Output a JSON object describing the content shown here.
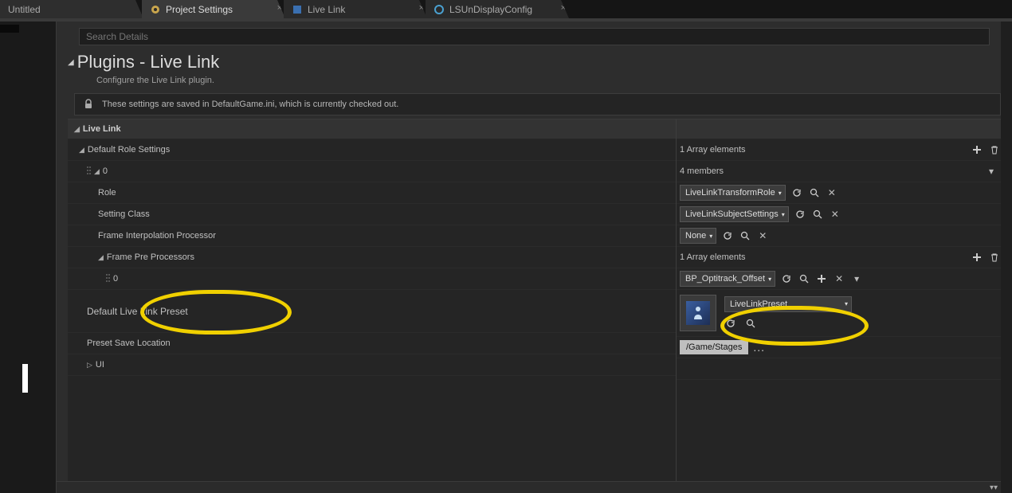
{
  "tabs": {
    "untitled": "Untitled",
    "project_settings": "Project Settings",
    "live_link": "Live Link",
    "display_config": "LSUnDisplayConfig"
  },
  "search": {
    "placeholder": "Search Details"
  },
  "page": {
    "title": "Plugins - Live Link",
    "subtitle": "Configure the Live Link plugin.",
    "info": "These settings are saved in DefaultGame.ini, which is currently checked out."
  },
  "section_live_link": "Live Link",
  "rows": {
    "default_role_settings": "Default Role Settings",
    "zero": "0",
    "role": "Role",
    "setting_class": "Setting Class",
    "frame_interp": "Frame Interpolation Processor",
    "frame_pre": "Frame Pre Processors",
    "pre_zero": "0",
    "default_preset": "Default Live Link Preset",
    "preset_save": "Preset Save Location",
    "ui": "UI"
  },
  "right": {
    "array1": "1 Array elements",
    "members4": "4 members",
    "transform_role": "LiveLinkTransformRole",
    "subject_settings": "LiveLinkSubjectSettings",
    "none": "None",
    "array1b": "1 Array elements",
    "optitrack": "BP_Optitrack_Offset",
    "preset_label": "LiveLinkPreset",
    "save_path": "/Game/Stages"
  }
}
